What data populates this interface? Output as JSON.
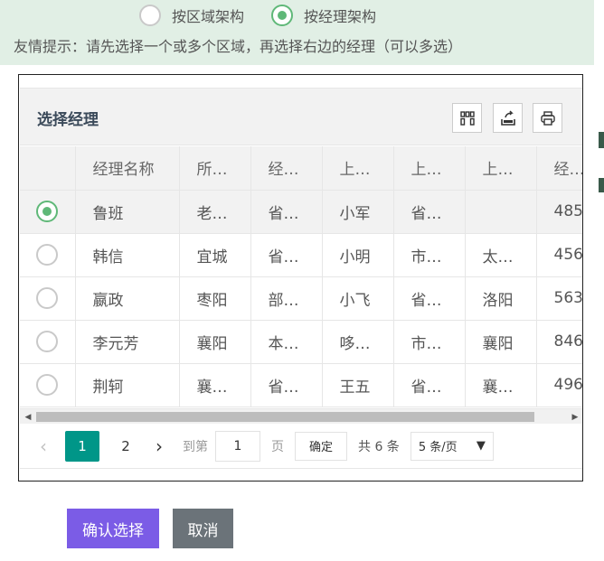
{
  "mode": {
    "options": [
      {
        "label": "按区域架构",
        "selected": false
      },
      {
        "label": "按经理架构",
        "selected": true
      }
    ]
  },
  "tip": "友情提示：请先选择一个或多个区域，再选择右边的经理（可以多选）",
  "panel": {
    "title": "选择经理",
    "tools": [
      {
        "name": "columns-icon"
      },
      {
        "name": "export-icon"
      },
      {
        "name": "print-icon"
      }
    ]
  },
  "table": {
    "columns": [
      "",
      "经理名称",
      "所…",
      "经…",
      "上…",
      "上…",
      "上…",
      "经…"
    ],
    "rows": [
      {
        "selected": true,
        "cells": [
          "鲁班",
          "老…",
          "省…",
          "小军",
          "省…",
          "",
          "485"
        ]
      },
      {
        "selected": false,
        "cells": [
          "韩信",
          "宜城",
          "省…",
          "小明",
          "市…",
          "太…",
          "456"
        ]
      },
      {
        "selected": false,
        "cells": [
          "嬴政",
          "枣阳",
          "部…",
          "小飞",
          "省…",
          "洛阳",
          "563"
        ]
      },
      {
        "selected": false,
        "cells": [
          "李元芳",
          "襄阳",
          "本…",
          "哆…",
          "市…",
          "襄阳",
          "846"
        ]
      },
      {
        "selected": false,
        "cells": [
          "荆轲",
          "襄…",
          "省…",
          "王五",
          "省…",
          "襄…",
          "496"
        ]
      }
    ]
  },
  "pager": {
    "prev": "‹",
    "pages": [
      "1",
      "2"
    ],
    "current": "1",
    "next": "›",
    "goto_label": "到第",
    "goto_value": "1",
    "page_unit": "页",
    "confirm_label": "确定",
    "total": "共 6 条",
    "page_size": "5 条/页",
    "page_size_caret": "▼"
  },
  "actions": {
    "confirm": "确认选择",
    "cancel": "取消"
  },
  "colors": {
    "banner_bg": "#e1efe5",
    "radio_on": "#5fb878",
    "pager_current": "#009688",
    "confirm_bg": "#7b5ce6",
    "cancel_bg": "#6b7379"
  }
}
